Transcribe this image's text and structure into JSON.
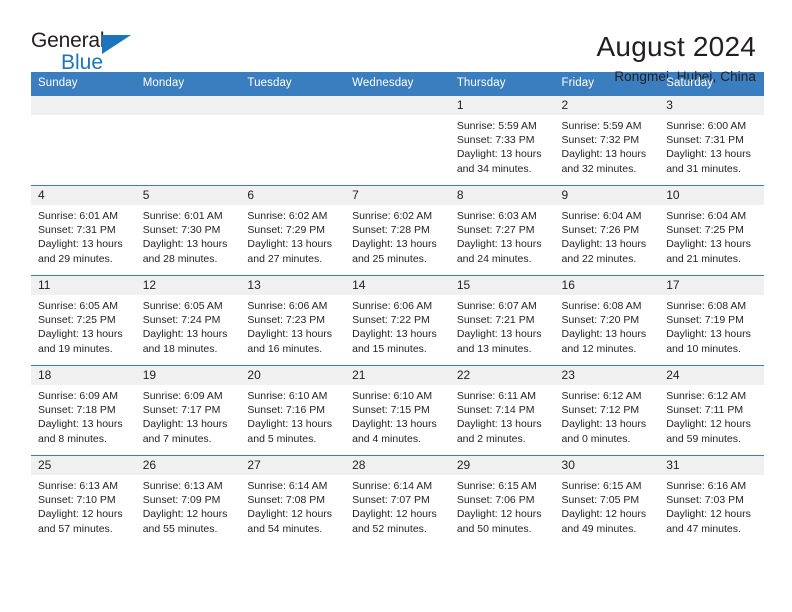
{
  "logo": {
    "word1": "General",
    "word2": "Blue",
    "triangle_color": "#1b75bb",
    "icon": "triangle-icon"
  },
  "header": {
    "title": "August 2024",
    "subtitle": "Rongmei, Hubei, China"
  },
  "theme": {
    "header_blue": "#3a7ebf",
    "daynum_bg": "#f0f0f0",
    "text": "#231f20"
  },
  "weekday_headers": [
    "Sunday",
    "Monday",
    "Tuesday",
    "Wednesday",
    "Thursday",
    "Friday",
    "Saturday"
  ],
  "weeks": [
    [
      {
        "day": "",
        "empty": true
      },
      {
        "day": "",
        "empty": true
      },
      {
        "day": "",
        "empty": true
      },
      {
        "day": "",
        "empty": true
      },
      {
        "day": "1",
        "sunrise": "Sunrise: 5:59 AM",
        "sunset": "Sunset: 7:33 PM",
        "daylight1": "Daylight: 13 hours",
        "daylight2": "and 34 minutes."
      },
      {
        "day": "2",
        "sunrise": "Sunrise: 5:59 AM",
        "sunset": "Sunset: 7:32 PM",
        "daylight1": "Daylight: 13 hours",
        "daylight2": "and 32 minutes."
      },
      {
        "day": "3",
        "sunrise": "Sunrise: 6:00 AM",
        "sunset": "Sunset: 7:31 PM",
        "daylight1": "Daylight: 13 hours",
        "daylight2": "and 31 minutes."
      }
    ],
    [
      {
        "day": "4",
        "sunrise": "Sunrise: 6:01 AM",
        "sunset": "Sunset: 7:31 PM",
        "daylight1": "Daylight: 13 hours",
        "daylight2": "and 29 minutes."
      },
      {
        "day": "5",
        "sunrise": "Sunrise: 6:01 AM",
        "sunset": "Sunset: 7:30 PM",
        "daylight1": "Daylight: 13 hours",
        "daylight2": "and 28 minutes."
      },
      {
        "day": "6",
        "sunrise": "Sunrise: 6:02 AM",
        "sunset": "Sunset: 7:29 PM",
        "daylight1": "Daylight: 13 hours",
        "daylight2": "and 27 minutes."
      },
      {
        "day": "7",
        "sunrise": "Sunrise: 6:02 AM",
        "sunset": "Sunset: 7:28 PM",
        "daylight1": "Daylight: 13 hours",
        "daylight2": "and 25 minutes."
      },
      {
        "day": "8",
        "sunrise": "Sunrise: 6:03 AM",
        "sunset": "Sunset: 7:27 PM",
        "daylight1": "Daylight: 13 hours",
        "daylight2": "and 24 minutes."
      },
      {
        "day": "9",
        "sunrise": "Sunrise: 6:04 AM",
        "sunset": "Sunset: 7:26 PM",
        "daylight1": "Daylight: 13 hours",
        "daylight2": "and 22 minutes."
      },
      {
        "day": "10",
        "sunrise": "Sunrise: 6:04 AM",
        "sunset": "Sunset: 7:25 PM",
        "daylight1": "Daylight: 13 hours",
        "daylight2": "and 21 minutes."
      }
    ],
    [
      {
        "day": "11",
        "sunrise": "Sunrise: 6:05 AM",
        "sunset": "Sunset: 7:25 PM",
        "daylight1": "Daylight: 13 hours",
        "daylight2": "and 19 minutes."
      },
      {
        "day": "12",
        "sunrise": "Sunrise: 6:05 AM",
        "sunset": "Sunset: 7:24 PM",
        "daylight1": "Daylight: 13 hours",
        "daylight2": "and 18 minutes."
      },
      {
        "day": "13",
        "sunrise": "Sunrise: 6:06 AM",
        "sunset": "Sunset: 7:23 PM",
        "daylight1": "Daylight: 13 hours",
        "daylight2": "and 16 minutes."
      },
      {
        "day": "14",
        "sunrise": "Sunrise: 6:06 AM",
        "sunset": "Sunset: 7:22 PM",
        "daylight1": "Daylight: 13 hours",
        "daylight2": "and 15 minutes."
      },
      {
        "day": "15",
        "sunrise": "Sunrise: 6:07 AM",
        "sunset": "Sunset: 7:21 PM",
        "daylight1": "Daylight: 13 hours",
        "daylight2": "and 13 minutes."
      },
      {
        "day": "16",
        "sunrise": "Sunrise: 6:08 AM",
        "sunset": "Sunset: 7:20 PM",
        "daylight1": "Daylight: 13 hours",
        "daylight2": "and 12 minutes."
      },
      {
        "day": "17",
        "sunrise": "Sunrise: 6:08 AM",
        "sunset": "Sunset: 7:19 PM",
        "daylight1": "Daylight: 13 hours",
        "daylight2": "and 10 minutes."
      }
    ],
    [
      {
        "day": "18",
        "sunrise": "Sunrise: 6:09 AM",
        "sunset": "Sunset: 7:18 PM",
        "daylight1": "Daylight: 13 hours",
        "daylight2": "and 8 minutes."
      },
      {
        "day": "19",
        "sunrise": "Sunrise: 6:09 AM",
        "sunset": "Sunset: 7:17 PM",
        "daylight1": "Daylight: 13 hours",
        "daylight2": "and 7 minutes."
      },
      {
        "day": "20",
        "sunrise": "Sunrise: 6:10 AM",
        "sunset": "Sunset: 7:16 PM",
        "daylight1": "Daylight: 13 hours",
        "daylight2": "and 5 minutes."
      },
      {
        "day": "21",
        "sunrise": "Sunrise: 6:10 AM",
        "sunset": "Sunset: 7:15 PM",
        "daylight1": "Daylight: 13 hours",
        "daylight2": "and 4 minutes."
      },
      {
        "day": "22",
        "sunrise": "Sunrise: 6:11 AM",
        "sunset": "Sunset: 7:14 PM",
        "daylight1": "Daylight: 13 hours",
        "daylight2": "and 2 minutes."
      },
      {
        "day": "23",
        "sunrise": "Sunrise: 6:12 AM",
        "sunset": "Sunset: 7:12 PM",
        "daylight1": "Daylight: 13 hours",
        "daylight2": "and 0 minutes."
      },
      {
        "day": "24",
        "sunrise": "Sunrise: 6:12 AM",
        "sunset": "Sunset: 7:11 PM",
        "daylight1": "Daylight: 12 hours",
        "daylight2": "and 59 minutes."
      }
    ],
    [
      {
        "day": "25",
        "sunrise": "Sunrise: 6:13 AM",
        "sunset": "Sunset: 7:10 PM",
        "daylight1": "Daylight: 12 hours",
        "daylight2": "and 57 minutes."
      },
      {
        "day": "26",
        "sunrise": "Sunrise: 6:13 AM",
        "sunset": "Sunset: 7:09 PM",
        "daylight1": "Daylight: 12 hours",
        "daylight2": "and 55 minutes."
      },
      {
        "day": "27",
        "sunrise": "Sunrise: 6:14 AM",
        "sunset": "Sunset: 7:08 PM",
        "daylight1": "Daylight: 12 hours",
        "daylight2": "and 54 minutes."
      },
      {
        "day": "28",
        "sunrise": "Sunrise: 6:14 AM",
        "sunset": "Sunset: 7:07 PM",
        "daylight1": "Daylight: 12 hours",
        "daylight2": "and 52 minutes."
      },
      {
        "day": "29",
        "sunrise": "Sunrise: 6:15 AM",
        "sunset": "Sunset: 7:06 PM",
        "daylight1": "Daylight: 12 hours",
        "daylight2": "and 50 minutes."
      },
      {
        "day": "30",
        "sunrise": "Sunrise: 6:15 AM",
        "sunset": "Sunset: 7:05 PM",
        "daylight1": "Daylight: 12 hours",
        "daylight2": "and 49 minutes."
      },
      {
        "day": "31",
        "sunrise": "Sunrise: 6:16 AM",
        "sunset": "Sunset: 7:03 PM",
        "daylight1": "Daylight: 12 hours",
        "daylight2": "and 47 minutes."
      }
    ]
  ]
}
